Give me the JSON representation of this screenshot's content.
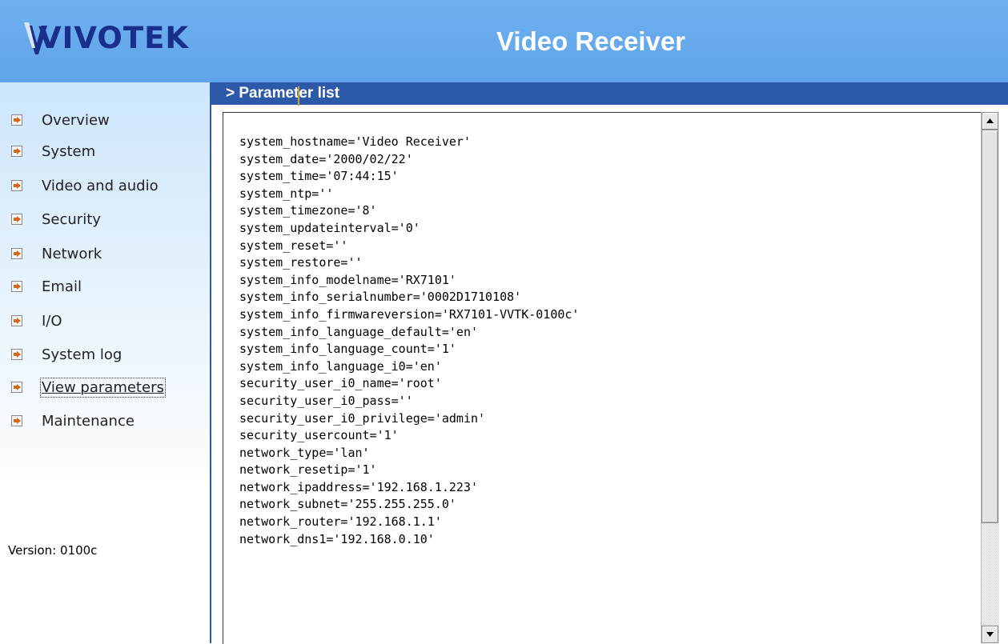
{
  "header": {
    "logo_text": "VIVOTEK",
    "title": "Video Receiver"
  },
  "sidebar": {
    "items": [
      {
        "label": "Overview"
      },
      {
        "label": "System"
      },
      {
        "label": "Video and audio"
      },
      {
        "label": "Security"
      },
      {
        "label": "Network"
      },
      {
        "label": "Email"
      },
      {
        "label": "I/O"
      },
      {
        "label": "System log"
      },
      {
        "label": "View parameters",
        "active": true
      },
      {
        "label": "Maintenance"
      }
    ],
    "version": "Version: 0100c"
  },
  "main": {
    "section_title": "> Parameter list",
    "parameters": [
      "system_hostname='Video Receiver'",
      "system_date='2000/02/22'",
      "system_time='07:44:15'",
      "system_ntp=''",
      "system_timezone='8'",
      "system_updateinterval='0'",
      "system_reset=''",
      "system_restore=''",
      "system_info_modelname='RX7101'",
      "system_info_serialnumber='0002D1710108'",
      "system_info_firmwareversion='RX7101-VVTK-0100c'",
      "system_info_language_default='en'",
      "system_info_language_count='1'",
      "system_info_language_i0='en'",
      "security_user_i0_name='root'",
      "security_user_i0_pass=''",
      "security_user_i0_privilege='admin'",
      "security_usercount='1'",
      "network_type='lan'",
      "network_resetip='1'",
      "network_ipaddress='192.168.1.223'",
      "network_subnet='255.255.255.0'",
      "network_router='192.168.1.1'",
      "network_dns1='192.168.0.10'"
    ]
  },
  "colors": {
    "header_bg": "#6fb1ef",
    "section_bar": "#2d5aa8",
    "logo": "#1a2f8a",
    "nav_arrow": "#d2691e"
  },
  "icons": {
    "nav_bullet": "arrow-right-icon",
    "scroll_up": "triangle-up-icon",
    "scroll_down": "triangle-down-icon"
  }
}
